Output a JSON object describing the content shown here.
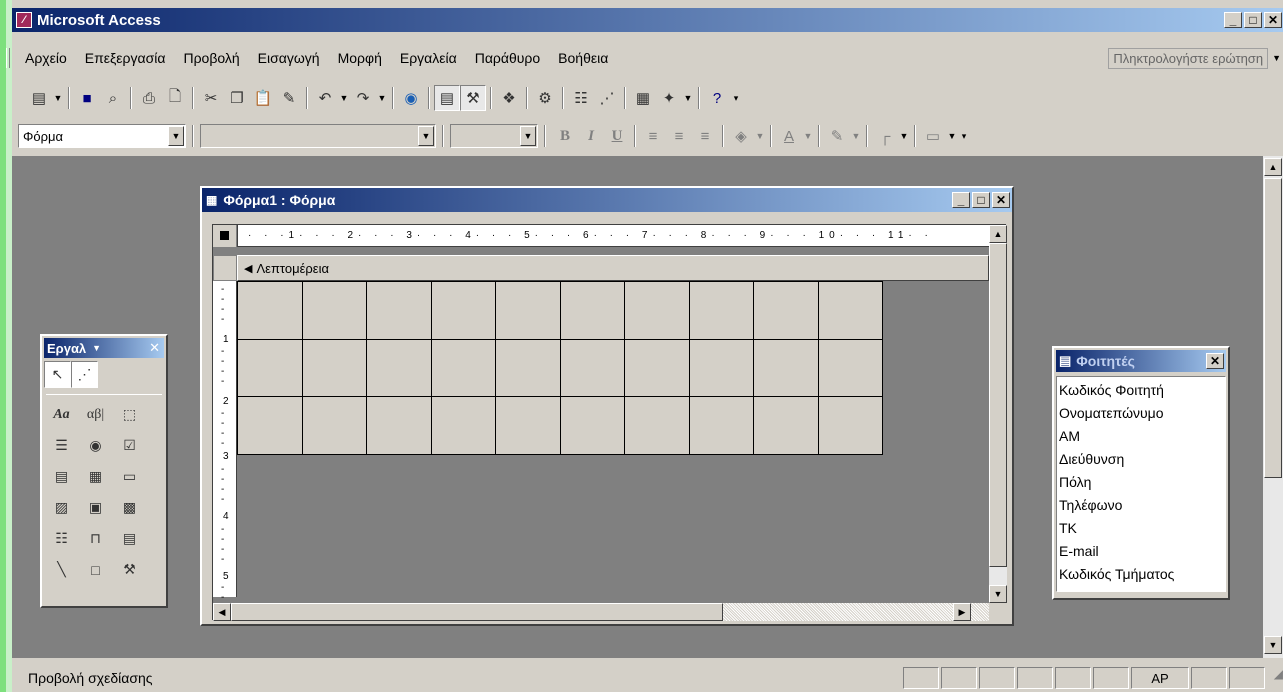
{
  "app": {
    "title": "Microsoft Access"
  },
  "menubar": {
    "items": [
      "Αρχείο",
      "Επεξεργασία",
      "Προβολή",
      "Εισαγωγή",
      "Μορφή",
      "Εργαλεία",
      "Παράθυρο",
      "Βοήθεια"
    ],
    "help_placeholder": "Πληκτρολογήστε ερώτηση"
  },
  "toolbar1": {
    "icons": [
      "form-view-icon",
      "save-icon",
      "search-icon",
      "print-icon",
      "print-preview-icon",
      "cut-icon",
      "copy-icon",
      "paste-icon",
      "format-painter-icon",
      "undo-icon",
      "redo-icon",
      "hyperlink-icon",
      "field-list-icon",
      "toolbox-icon",
      "autoformat-icon",
      "code-icon",
      "properties-icon",
      "build-icon",
      "database-window-icon",
      "new-object-icon",
      "help-icon"
    ]
  },
  "toolbar2": {
    "object_combo": "Φόρμα",
    "font_combo": "",
    "size_combo": "",
    "bold": "B",
    "italic": "I",
    "underline": "U"
  },
  "form_window": {
    "title": "Φόρμα1 : Φόρμα",
    "section_label": "Λεπτομέρεια",
    "ruler_numbers": [
      "1",
      "2",
      "3",
      "4",
      "5",
      "6",
      "7",
      "8",
      "9",
      "10",
      "11"
    ],
    "vruler_numbers": [
      "1",
      "2",
      "3",
      "4",
      "5"
    ],
    "grid_columns": 10,
    "grid_rows": 3
  },
  "toolbox": {
    "title": "Εργαλ",
    "label_tool": "Aa",
    "textbox_tool": "αβ|"
  },
  "fieldlist": {
    "title": "Φοιτητές",
    "fields": [
      "Κωδικός Φοιτητή",
      "Ονοματεπώνυμο",
      "ΑΜ",
      "Διεύθυνση",
      "Πόλη",
      "Τηλέφωνο",
      "ΤΚ",
      "E-mail",
      "Κωδικός Τμήματος"
    ]
  },
  "statusbar": {
    "text": "Προβολή σχεδίασης",
    "indicator": "ΑΡ"
  },
  "colors": {
    "title_start": "#0a246a",
    "title_end": "#a6caf0",
    "desktop": "#808080",
    "outer_border": "#7de07d"
  }
}
